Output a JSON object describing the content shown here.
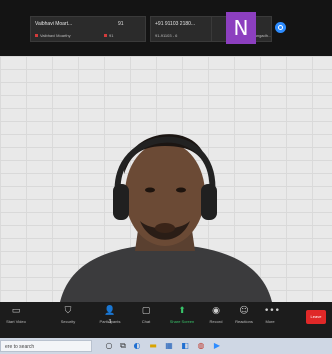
{
  "participants": [
    {
      "name": "Vaibhavi Moart...",
      "sub": "Vaibhavi Moarthy"
    },
    {
      "name": "91",
      "sub": "91"
    },
    {
      "name": "+91 91103 2180...",
      "sub": "91-91103 - 6"
    },
    {
      "name": "",
      "sub": "Vrishank Gangadh..."
    }
  ],
  "avatar_letter": "N",
  "toolbar": {
    "items": [
      {
        "label": "Start Video",
        "icon": "video-camera-icon"
      },
      {
        "label": "Security",
        "icon": "shield-icon"
      },
      {
        "label": "Participants",
        "icon": "participants-icon"
      },
      {
        "label": "Chat",
        "icon": "chat-icon"
      },
      {
        "label": "Share Screen",
        "icon": "share-screen-icon"
      },
      {
        "label": "Record",
        "icon": "record-icon"
      },
      {
        "label": "Reactions",
        "icon": "smiley-icon"
      },
      {
        "label": "More",
        "icon": "more-icon"
      }
    ],
    "participant_count": "3",
    "end_label": "Leave"
  },
  "taskbar": {
    "search_placeholder": "ere to search"
  },
  "colors": {
    "accent_purple": "#8c3fbf",
    "zoom_blue": "#2d8cff",
    "share_green": "#39c46a",
    "end_red": "#e02828"
  }
}
